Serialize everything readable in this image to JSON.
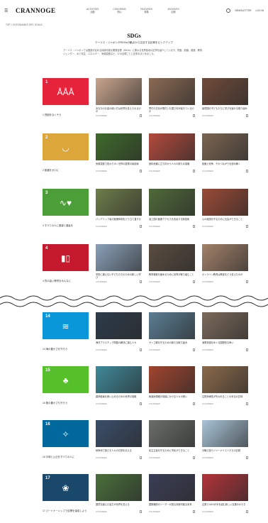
{
  "header": {
    "menu_icon": "menu-icon",
    "logo": "CRANNOGE",
    "nav": [
      {
        "top": "ACTIVITIES",
        "bottom": "活動"
      },
      {
        "top": "CONCERNS",
        "bottom": "関心"
      },
      {
        "top": "FEATURES",
        "bottom": "特集"
      },
      {
        "top": "ARCHIVES",
        "bottom": "記録"
      }
    ],
    "search_icon": "search-icon",
    "right_links": [
      "NEWSLETTER",
      "LOG IN"
    ]
  },
  "breadcrumb": "TOP > SUSTAINABLE DEV. GOALS",
  "intro": {
    "title": "SDGs",
    "subtitle": "クーリエ・ジャポンがSDGsの観点から注目する記事をピックアップ",
    "description": "クーリエ・ジャポンでは国連が定める持続可能な開発目標（SDGs）に関わる世界各地の記事を紹介しています。貧困、飢餓、健康、教育、ジェンダー、水と衛生、エネルギー、気候変動など、17の目標ごとに記事をまとめました。"
  },
  "rows": [
    {
      "goal_color": "#E5243B",
      "goal_number": "1",
      "goal_glyph": "ÅÅÅ",
      "goal_label": "1 貧困をなくそう",
      "articles": [
        {
          "color": "#c9a58d",
          "title": "あなたのお金の使い方は世界を変えられるのか",
          "meta": "COURRiER"
        },
        {
          "color": "#8a6a54",
          "title": "寄付の文化が根付いた国で何が起きているのか",
          "meta": "COURRiER"
        },
        {
          "color": "#6f4b3a",
          "title": "最貧国の子どもたちに学びを届ける取り組み",
          "meta": "COURRiER"
        }
      ]
    },
    {
      "goal_color": "#DDA63A",
      "goal_number": "2",
      "goal_glyph": "◡",
      "goal_label": "2 飢餓をゼロに",
      "articles": [
        {
          "color": "#3f6b2a",
          "title": "気候変動で変わりゆく世界の農業の最前線",
          "meta": "COURRiER"
        },
        {
          "color": "#b24a3c",
          "title": "食料危機に立ち向かう人々の新たな挑戦",
          "meta": "COURRiER"
        },
        {
          "color": "#7b6552",
          "title": "飢餓と紛争、そのつながりを読み解く",
          "meta": "COURRiER"
        }
      ]
    },
    {
      "goal_color": "#4C9F38",
      "goal_number": "3",
      "goal_glyph": "∿♥",
      "goal_label": "3 すべての人に健康と福祉を",
      "articles": [
        {
          "color": "#6e7e4a",
          "title": "パンデミック後の医療体制をどう立て直すか",
          "meta": "COURRiER"
        },
        {
          "color": "#4f6a39",
          "title": "途上国の医療アクセスを改善する新技術",
          "meta": "COURRiER"
        },
        {
          "color": "#9b4a35",
          "title": "心の健康を守るために社会ができること",
          "meta": "COURRiER"
        }
      ]
    },
    {
      "goal_color": "#C5192D",
      "goal_number": "4",
      "goal_glyph": "▮▯",
      "goal_label": "4 質の高い教育をみんなに",
      "articles": [
        {
          "color": "#8aa1b8",
          "title": "学校に通えない子どもたちのための新しい学び",
          "meta": "COURRiER"
        },
        {
          "color": "#5a4c3f",
          "title": "教育格差を縮めるために世界が取り組むこと",
          "meta": "COURRiER"
        },
        {
          "color": "#a3826a",
          "title": "オンライン教育は教室をどう変えたのか",
          "meta": "COURRiER"
        }
      ]
    }
  ],
  "rows_after_break": [
    {
      "goal_color": "#0A97D9",
      "goal_number": "14",
      "goal_glyph": "≋",
      "goal_label": "14 海の豊かさを守ろう",
      "articles": [
        {
          "color": "#2d3b4a",
          "title": "海洋プラスチック問題の解決に挑む人々",
          "meta": "COURRiER"
        },
        {
          "color": "#5a7d92",
          "title": "サンゴ礁を守るための新たな取り組み",
          "meta": "COURRiER"
        },
        {
          "color": "#7c6a5b",
          "title": "漁業資源をめぐる国際的な争い",
          "meta": "COURRiER"
        }
      ]
    },
    {
      "goal_color": "#56C02B",
      "goal_number": "15",
      "goal_glyph": "♣",
      "goal_label": "15 陸の豊かさも守ろう",
      "articles": [
        {
          "color": "#3f8a9a",
          "title": "森林破壊を食い止めるための世界の挑戦",
          "meta": "COURRiER"
        },
        {
          "color": "#a1442e",
          "title": "絶滅危惧種の保護にかける人々の想い",
          "meta": "COURRiER"
        },
        {
          "color": "#8a6a4a",
          "title": "生物多様性が失われることの本当の意味",
          "meta": "COURRiER"
        }
      ]
    },
    {
      "goal_color": "#00689D",
      "goal_number": "16",
      "goal_glyph": "✧",
      "goal_label": "16 平和と公正をすべての人に",
      "articles": [
        {
          "color": "#3a4e6a",
          "title": "紛争地で暮らす人々の日常を伝える",
          "meta": "COURRiER"
        },
        {
          "color": "#6a6e6a",
          "title": "民主主義を守るために市民ができること",
          "meta": "COURRiER"
        },
        {
          "color": "#a9c5d8",
          "title": "汚職と闘うジャーナリストたちの記録",
          "meta": "COURRiER"
        }
      ]
    },
    {
      "goal_color": "#19486A",
      "goal_number": "17",
      "goal_glyph": "❀",
      "goal_label": "17 パートナーシップで目標を達成しよう",
      "articles": [
        {
          "color": "#4a6f3a",
          "title": "国境を越えた協力が世界を変える",
          "meta": "COURRiER"
        },
        {
          "color": "#3a3e55",
          "title": "国際機関のリーダーが語る持続可能な未来",
          "meta": "COURRiER"
        },
        {
          "color": "#b3343a",
          "title": "企業とNGOが手を組む新しい支援のかたち",
          "meta": "COURRiER"
        }
      ]
    }
  ]
}
